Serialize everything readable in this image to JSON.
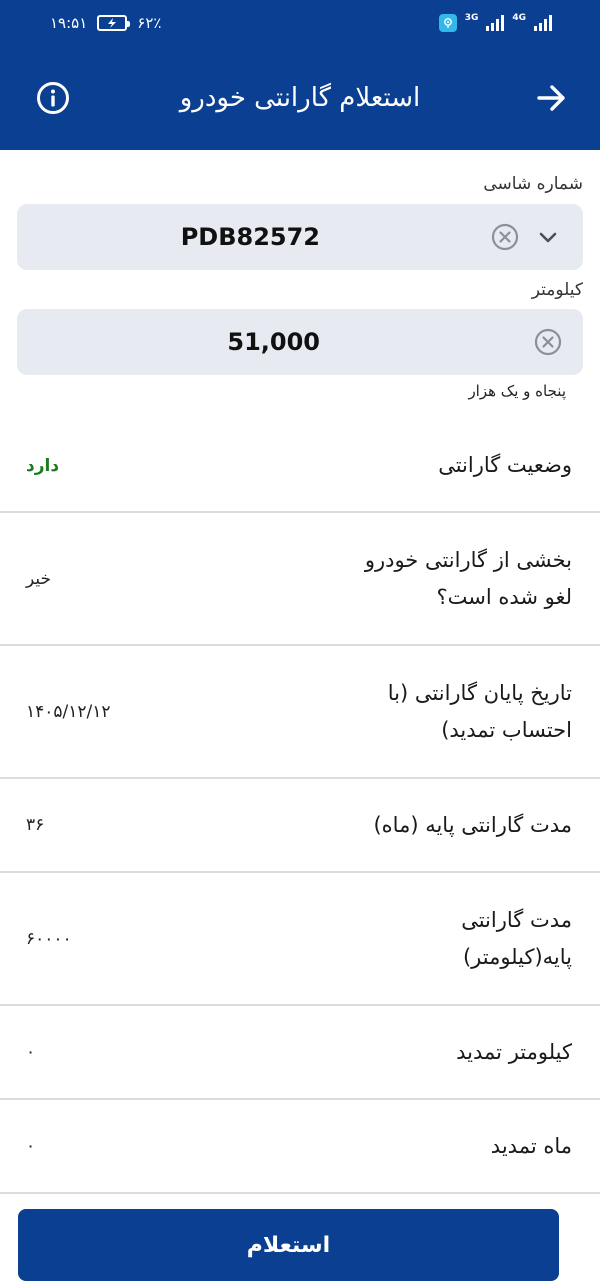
{
  "status_bar": {
    "time": "۱۹:۵۱",
    "battery_percent": "۶۲٪",
    "network_tag_1": "3G",
    "network_tag_2": "4G"
  },
  "header": {
    "title": "استعلام گارانتی خودرو"
  },
  "form": {
    "chassis_label": "شماره شاسی",
    "chassis_value": "PDB82572",
    "km_label": "کیلومتر",
    "km_value": "51,000",
    "km_words": "پنجاه و یک هزار"
  },
  "results": [
    {
      "label": "وضعیت گارانتی",
      "value": "دارد"
    },
    {
      "label": "بخشی از گارانتی خودرو لغو شده است؟",
      "value": "خیر"
    },
    {
      "label": "تاریخ پایان گارانتی (با احتساب تمدید)",
      "value": "۱۴۰۵/۱۲/۱۲"
    },
    {
      "label": "مدت گارانتی پایه (ماه)",
      "value": "۳۶"
    },
    {
      "label": "مدت گارانتی پایه(کیلومتر)",
      "value": "۶۰۰۰۰"
    },
    {
      "label": "کیلومتر تمدید",
      "value": "۰"
    },
    {
      "label": "ماه تمدید",
      "value": "۰"
    }
  ],
  "actions": {
    "submit_label": "استعلام"
  },
  "colors": {
    "primary": "#0a3f91",
    "success": "#1e7a1e",
    "field_bg": "#e7ebf1"
  }
}
